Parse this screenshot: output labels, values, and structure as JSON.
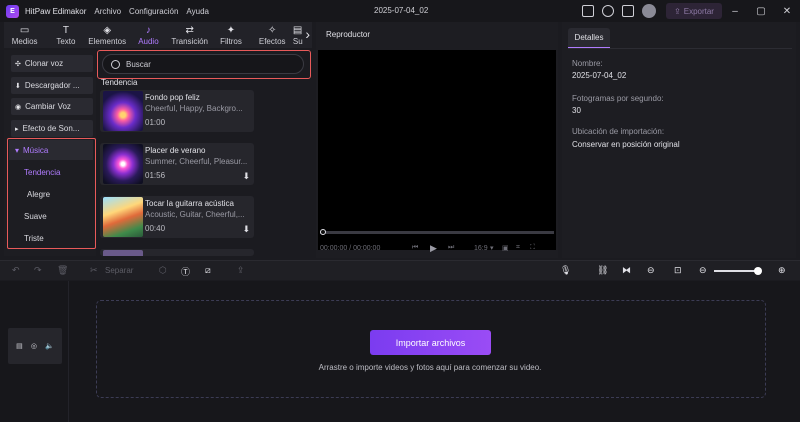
{
  "app": {
    "name": "HitPaw Edimakor",
    "logo_text": "E",
    "document_title": "2025-07-04_02"
  },
  "menu": [
    "Archivo",
    "Configuración",
    "Ayuda"
  ],
  "titlebar": {
    "export_label": "Exportar"
  },
  "tabs": [
    {
      "label": "Medios",
      "icon": "folder-icon",
      "glyph": "▭"
    },
    {
      "label": "Texto",
      "icon": "text-icon",
      "glyph": "T"
    },
    {
      "label": "Elementos",
      "icon": "elements-icon",
      "glyph": "◈"
    },
    {
      "label": "Audio",
      "icon": "music-note-icon",
      "glyph": "♪"
    },
    {
      "label": "Transición",
      "icon": "transition-icon",
      "glyph": "⇄"
    },
    {
      "label": "Filtros",
      "icon": "filter-icon",
      "glyph": "✦"
    },
    {
      "label": "Efectos",
      "icon": "effects-icon",
      "glyph": "✧"
    },
    {
      "label": "Su",
      "icon": "subtitle-icon",
      "glyph": "▤"
    }
  ],
  "active_tab": "Audio",
  "leftnav": {
    "buttons": [
      "Clonar voz",
      "Descargador ...",
      "Cambiar Voz",
      "Efecto de Son..."
    ],
    "music_label": "Música",
    "subitems": [
      "Tendencia",
      "Alegre",
      "Suave",
      "Triste"
    ]
  },
  "search": {
    "placeholder": "Buscar"
  },
  "section_label": "Tendencia",
  "tracks": [
    {
      "title": "Fondo pop feliz",
      "tags": "Cheerful, Happy, Backgro...",
      "duration": "01:00"
    },
    {
      "title": "Placer de verano",
      "tags": "Summer, Cheerful, Pleasur...",
      "duration": "01:56"
    },
    {
      "title": "Tocar la guitarra acústica",
      "tags": "Acoustic, Guitar, Cheerful,...",
      "duration": "00:40"
    }
  ],
  "player": {
    "title": "Reproductor",
    "time": "00:00:00 / 00:00:00",
    "aspect": "16:9",
    "progress": 0
  },
  "details": {
    "tab_label": "Detalles",
    "name_label": "Nombre:",
    "name_value": "2025-07-04_02",
    "fps_label": "Fotogramas por segundo:",
    "fps_value": "30",
    "location_label": "Ubicación de importación:",
    "location_value": "Conservar en posición original"
  },
  "toolbar": {
    "split_label": "Separar",
    "zoom_level": 0.88
  },
  "timeline": {
    "import_label": "Importar archivos",
    "hint": "Arrastre o importe videos y fotos aquí para comenzar su video."
  },
  "colors": {
    "accent": "#b07cff",
    "highlight_border": "#e85a5a",
    "import_button": "#8a45f3"
  }
}
